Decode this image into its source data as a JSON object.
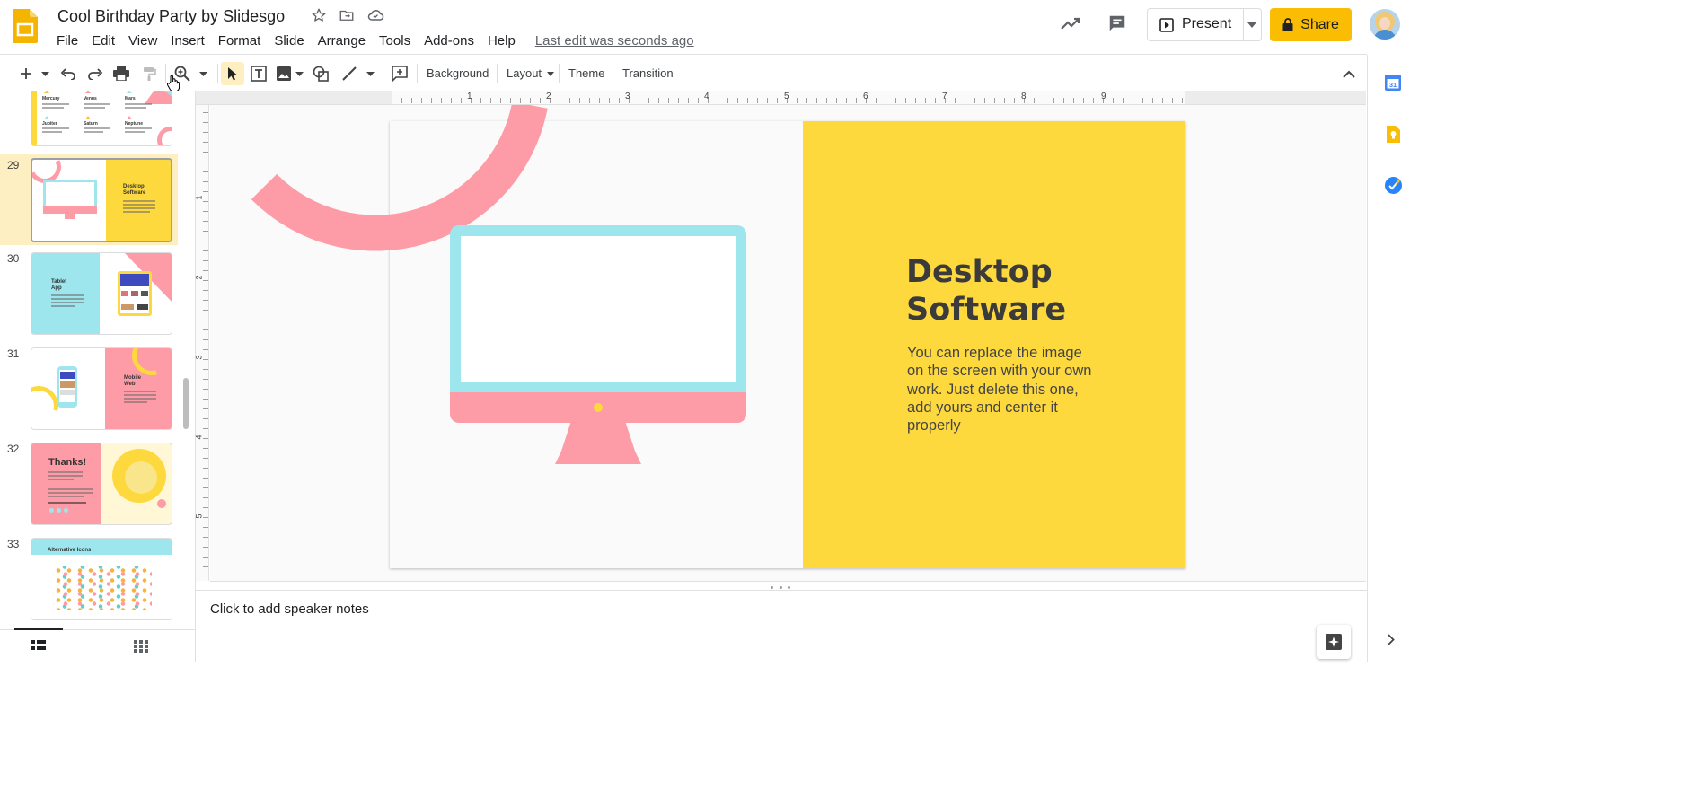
{
  "app": {
    "doc_title": "Cool Birthday Party by Slidesgo",
    "last_edit": "Last edit was seconds ago",
    "menu": [
      "File",
      "Edit",
      "View",
      "Insert",
      "Format",
      "Slide",
      "Arrange",
      "Tools",
      "Add-ons",
      "Help"
    ],
    "present_label": "Present",
    "share_label": "Share"
  },
  "toolbar": {
    "background_label": "Background",
    "layout_label": "Layout",
    "theme_label": "Theme",
    "transition_label": "Transition"
  },
  "ruler": {
    "h_ticks": [
      "1",
      "2",
      "3",
      "4",
      "5",
      "6",
      "7",
      "8",
      "9"
    ],
    "v_ticks": [
      "1",
      "2",
      "3",
      "4",
      "5"
    ]
  },
  "slide": {
    "title_line1": "Desktop",
    "title_line2": "Software",
    "body": "You can replace the image on the screen with your own work. Just delete this one, add yours and center it properly"
  },
  "filmstrip": {
    "numbers": [
      "29",
      "30",
      "31",
      "32",
      "33"
    ],
    "t28": {
      "a": "Mercury",
      "b": "Venus",
      "c": "Mars",
      "d": "Jupiter",
      "e": "Saturn",
      "f": "Neptune"
    },
    "t29": {
      "title1": "Desktop",
      "title2": "Software"
    },
    "t30": {
      "title1": "Tablet",
      "title2": "App"
    },
    "t31": {
      "title1": "Mobile",
      "title2": "Web"
    },
    "t32": {
      "title": "Thanks!"
    },
    "t33": {
      "title": "Alternative Icons"
    }
  },
  "notes": {
    "placeholder": "Click to add speaker notes"
  },
  "colors": {
    "accent_yellow": "#fbbc04",
    "slide_yellow": "#fdd93e",
    "pink": "#fd9ba6",
    "cyan": "#9de6ee",
    "selected_bg": "#feefc3"
  }
}
